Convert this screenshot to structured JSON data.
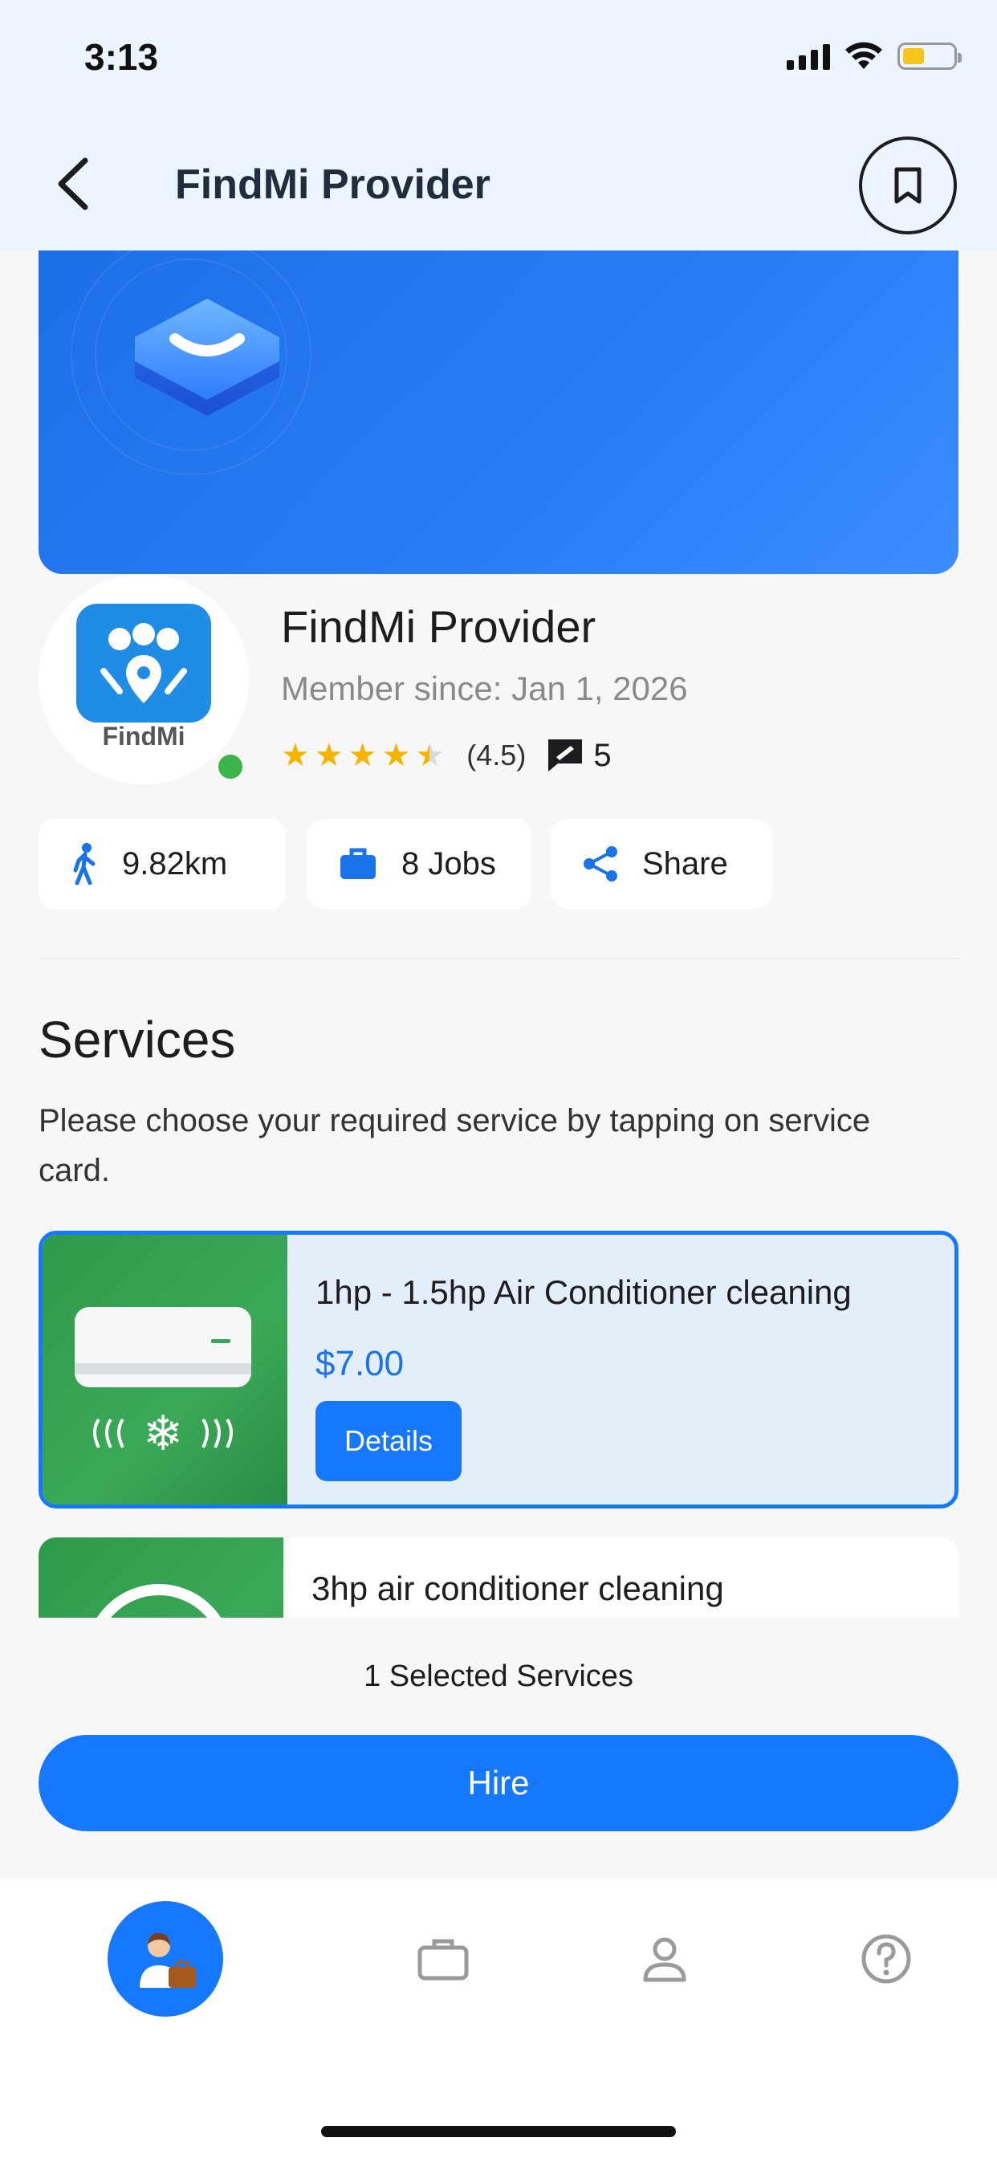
{
  "status_bar": {
    "time": "3:13"
  },
  "header": {
    "title": "FindMi Provider"
  },
  "provider": {
    "logo_text": "FindMi",
    "name": "FindMi Provider",
    "member_since": "Member since: Jan 1, 2026",
    "rating_label": "(4.5)",
    "rating_value": 4.5,
    "review_count": "5",
    "online": true
  },
  "chips": [
    {
      "label": "9.82km",
      "icon": "walking-icon"
    },
    {
      "label": "8 Jobs",
      "icon": "briefcase-icon"
    },
    {
      "label": "Share",
      "icon": "share-icon"
    }
  ],
  "services": {
    "title": "Services",
    "description": "Please choose your required service by tapping on service card.",
    "items": [
      {
        "title": "1hp - 1.5hp Air Conditioner cleaning",
        "price": "$7.00",
        "details_label": "Details",
        "selected": true
      },
      {
        "title": "3hp air conditioner cleaning",
        "selected": false
      }
    ]
  },
  "footer": {
    "selected_count": "1 Selected Services",
    "hire_label": "Hire"
  },
  "tabbar": {
    "items": [
      {
        "icon": "provider-avatar-icon",
        "active": true
      },
      {
        "icon": "briefcase-icon",
        "active": false
      },
      {
        "icon": "user-icon",
        "active": false
      },
      {
        "icon": "help-icon",
        "active": false
      }
    ]
  },
  "colors": {
    "accent": "#1677ff",
    "header_bg": "#ecf4fd",
    "star": "#f5b400",
    "online": "#3cb44b",
    "price": "#1a73e8"
  }
}
